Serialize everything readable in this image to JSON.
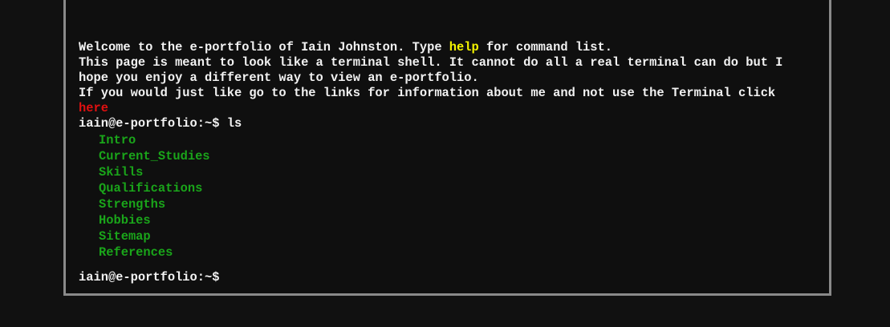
{
  "intro": {
    "welcome_prefix": "Welcome to the e-portfolio of Iain Johnston. Type ",
    "help_word": "help",
    "welcome_suffix": " for command list.",
    "line2": "This page is meant to look like a terminal shell. It cannot do all a real terminal can do but I hope you enjoy a different way to view an e-portfolio.",
    "line3": "If you would just like go to the links for information about me and not use the Terminal click",
    "here_link": "here"
  },
  "prompt": "iain@e-portfolio:~$",
  "command": "ls",
  "ls_items": [
    "Intro",
    "Current_Studies",
    "Skills",
    "Qualifications",
    "Strengths",
    "Hobbies",
    "Sitemap",
    "References"
  ],
  "input_value": "",
  "colors": {
    "background": "#111111",
    "text": "#f2f2f2",
    "highlight": "#f5f500",
    "link": "#e01010",
    "directory": "#1aa51a",
    "border": "#8a8a8a"
  }
}
